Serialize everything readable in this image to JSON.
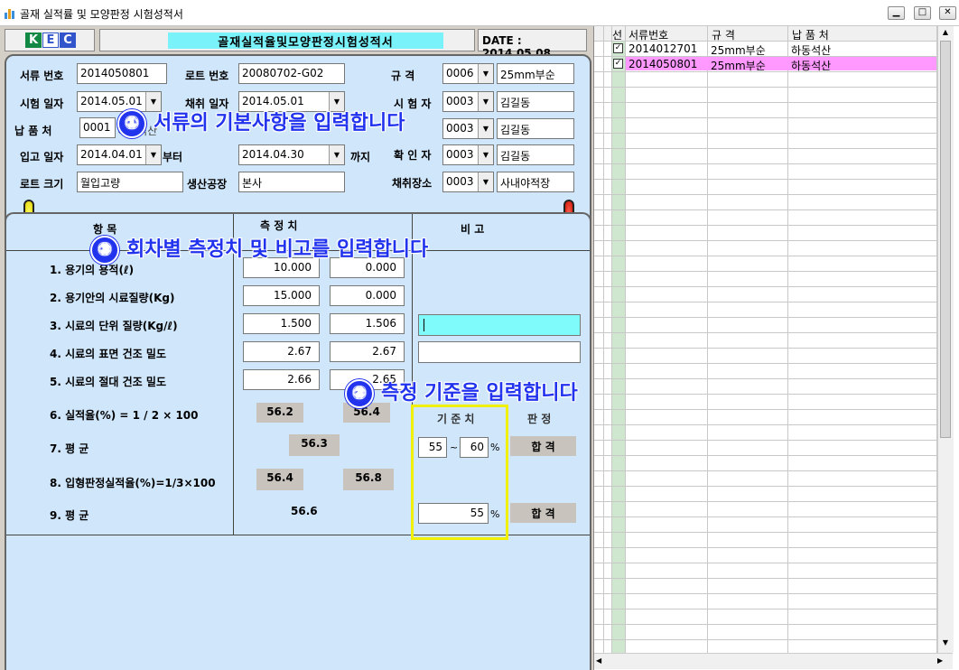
{
  "window": {
    "title": "골재 실적률 및 모양판정 시험성적서"
  },
  "header": {
    "logo": "KEC",
    "form_title": "골재실적율및모양판정시험성적서",
    "date": "DATE : 2014.05.08"
  },
  "basic": {
    "doc_no_label": "서류 번호",
    "doc_no": "2014050801",
    "lot_no_label": "로트 번호",
    "lot_no": "20080702-G02",
    "spec_label": "규    격",
    "spec_code": "0006",
    "spec_name": "25mm부순",
    "test_date_label": "시험 일자",
    "test_date": "2014.05.01",
    "sample_date_label": "채취 일자",
    "sample_date": "2014.05.01",
    "tester_label": "시 험 자",
    "tester_code": "0003",
    "tester_name": "김길동",
    "supplier_label": "납 품 처",
    "supplier_code": "0001",
    "supplier_name": "하동석산",
    "person2_code": "0003",
    "person2_name": "김길동",
    "in_date_label": "입고 일자",
    "in_date_from": "2014.04.01",
    "from_label": "부터",
    "in_date_to": "2014.04.30",
    "to_label": "까지",
    "checker_label": "확 인 자",
    "checker_code": "0003",
    "checker_name": "김길동",
    "lot_size_label": "로트 크기",
    "lot_size": "월입고량",
    "factory_label": "생산공장",
    "factory": "본사",
    "place_label": "채취장소",
    "place_code": "0003",
    "place_name": "사내야적장"
  },
  "measure": {
    "col_item": "항      목",
    "col_value": "측  정  치",
    "col_note": "비      고",
    "rows": [
      {
        "label": "1. 용기의 용적(ℓ)",
        "v1": "10.000",
        "v2": "0.000"
      },
      {
        "label": "2. 용기안의 시료질량(Kg)",
        "v1": "15.000",
        "v2": "0.000"
      },
      {
        "label": "3. 시료의 단위 질량(Kg/ℓ)",
        "v1": "1.500",
        "v2": "1.506"
      },
      {
        "label": "4. 시료의 표면 건조 밀도",
        "v1": "2.67",
        "v2": "2.67"
      },
      {
        "label": "5. 시료의 절대 건조 밀도",
        "v1": "2.66",
        "v2": "2.65"
      }
    ],
    "r6_label": "6. 실적율(%) =  1 / 2 × 100",
    "r6_v1": "56.2",
    "r6_v2": "56.4",
    "r7_label": "7. 평            균",
    "r7_v": "56.3",
    "r8_label": "8. 입형판정실적율(%)=1/3×100",
    "r8_v1": "56.4",
    "r8_v2": "56.8",
    "r9_label": "9. 평            균",
    "r9_v": "56.6",
    "std_label": "기 준 치",
    "judge_label": "판 정",
    "std_min": "55",
    "tilde": "~",
    "std_max": "60",
    "pct": "%",
    "std2": "55",
    "pct2": "%",
    "judge1": "합 격",
    "judge2": "합 격"
  },
  "annotations": {
    "a1_num": "①",
    "a1": "서류의 기본사항을 입력합니다",
    "a2_num": "②",
    "a2": "측정 기준을 입력합니다",
    "a3_num": "③",
    "a3": "회차별 측정치 및 비고를 입력합니다"
  },
  "grid": {
    "headers": [
      "선",
      "서류번호",
      "규  격",
      "납 품 처"
    ],
    "rows": [
      {
        "checked": true,
        "doc": "2014012701",
        "spec": "25mm부순",
        "supplier": "하동석산",
        "selected": false
      },
      {
        "checked": true,
        "doc": "2014050801",
        "spec": "25mm부순",
        "supplier": "하동석산",
        "selected": true
      }
    ]
  },
  "colors": {
    "panel": "#cfe6fb",
    "annotation": "#2233ee",
    "highlight_box": "#f0f000",
    "selected_row": "#ff99ff",
    "active_field": "#7ffbfb",
    "title_band": "#79f3f9"
  }
}
